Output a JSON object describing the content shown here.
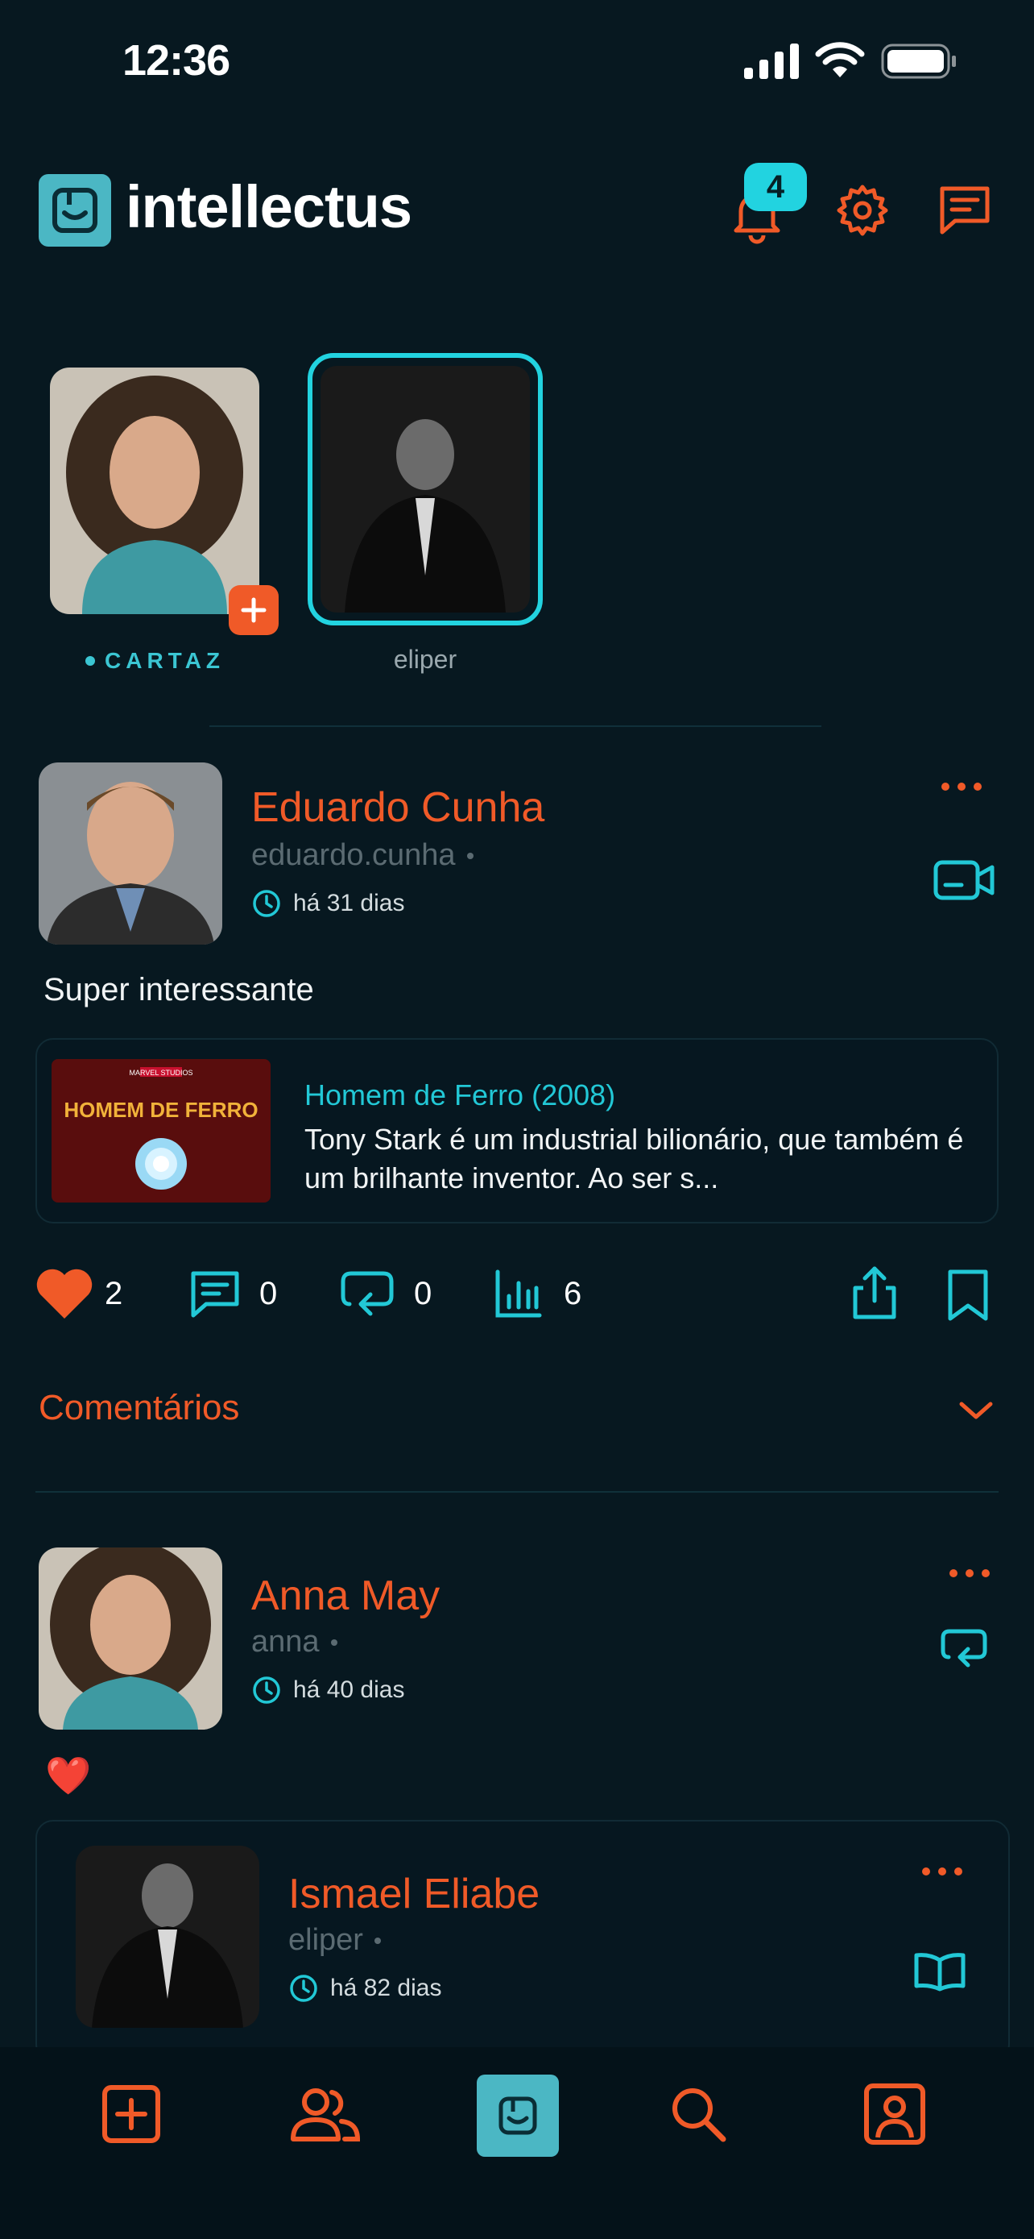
{
  "status_bar": {
    "time": "12:36"
  },
  "header": {
    "app_name": "intellectus",
    "notification_count": "4"
  },
  "stories": [
    {
      "label": "CARTAZ"
    },
    {
      "label": "eliper"
    }
  ],
  "post": {
    "author_name": "Eduardo Cunha",
    "author_handle": "eduardo.cunha",
    "time": "há 31 dias",
    "text": "Super interessante",
    "link": {
      "title": "Homem de Ferro (2008)",
      "description": "Tony Stark é um industrial bilionário, que também é um brilhante inventor. Ao ser s...",
      "thumb_text": "HOMEM DE FERRO",
      "thumb_brand": "MARVEL STUDIOS"
    },
    "likes": "2",
    "comments": "0",
    "reposts": "0",
    "views": "6"
  },
  "comments_section": {
    "label": "Comentários"
  },
  "comment": {
    "author_name": "Anna May",
    "author_handle": "anna",
    "time": "há 40 dias",
    "text": "❤️"
  },
  "reply": {
    "author_name": "Ismael Eliabe",
    "author_handle": "eliper",
    "time": "há 82 dias"
  },
  "colors": {
    "background": "#071820",
    "accent_orange": "#f05a28",
    "accent_cyan": "#22d3e0",
    "logo_teal": "#4bb7c4"
  }
}
